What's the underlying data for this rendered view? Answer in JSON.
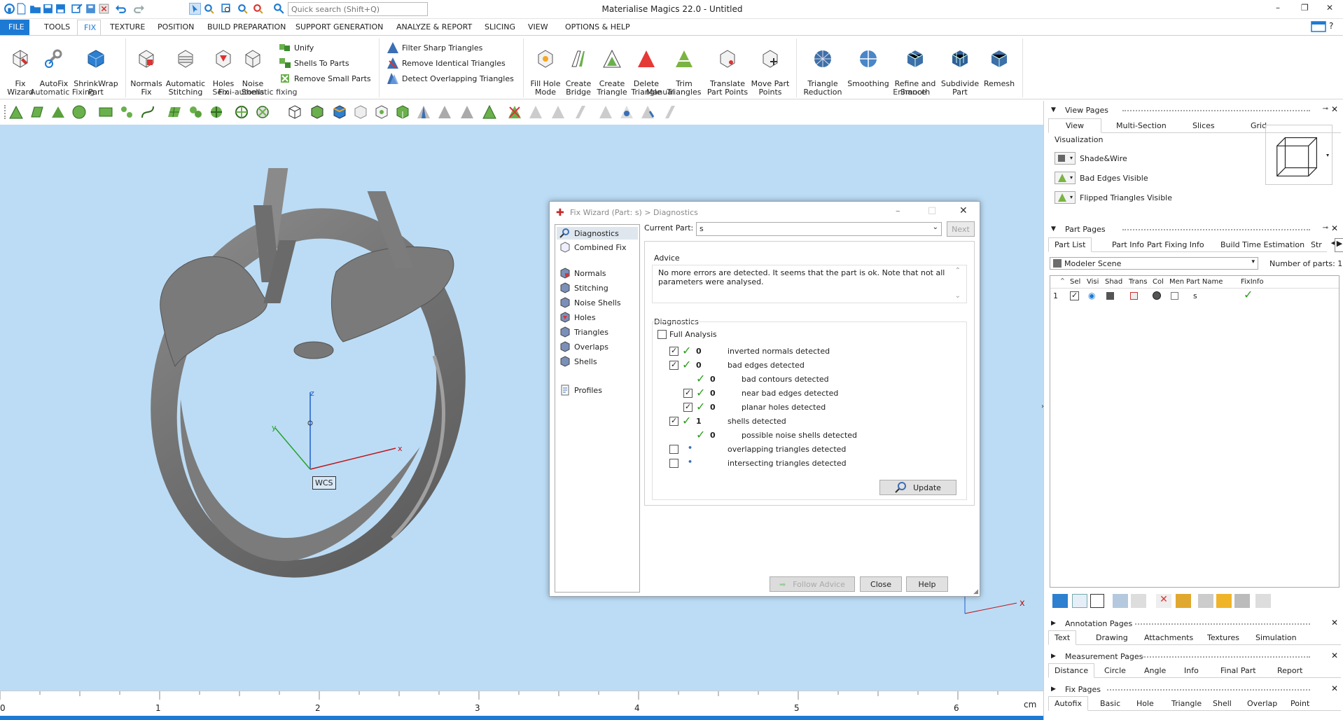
{
  "title_bar": {
    "window_title": "Materialise Magics 22.0 - Untitled",
    "search_placeholder": "Quick search (Shift+Q)",
    "minimize": "–",
    "restore": "❐",
    "close": "✕"
  },
  "menu": {
    "file": "FILE",
    "items": [
      "TOOLS",
      "FIX",
      "TEXTURE",
      "POSITION",
      "BUILD PREPARATION",
      "SUPPORT GENERATION",
      "ANALYZE & REPORT",
      "SLICING",
      "VIEW",
      "OPTIONS & HELP"
    ],
    "active": "FIX"
  },
  "ribbon": {
    "automatic_fixing": {
      "label": "Automatic Fixing",
      "buttons": [
        "Fix\nWizard",
        "AutoFix",
        "ShrinkWrap\nPart"
      ]
    },
    "semi_automatic": {
      "label": "Semi-automatic fixing",
      "buttons": [
        "Normals\nFix",
        "Automatic\nStitching",
        "Holes\nFix",
        "Noise\nShells"
      ],
      "small": [
        "Unify",
        "Shells To Parts",
        "Remove Small Parts"
      ]
    },
    "triangles_small": [
      "Filter Sharp Triangles",
      "Remove Identical Triangles",
      "Detect Overlapping Triangles"
    ],
    "manual": {
      "label": "Manual",
      "buttons": [
        "Fill Hole\nMode",
        "Create\nBridge",
        "Create\nTriangle",
        "Delete\nTriangle",
        "Trim\nTriangles",
        "Translate\nPart Points",
        "Move Part\nPoints"
      ]
    },
    "enhance": {
      "label": "Enhance",
      "buttons": [
        "Triangle\nReduction",
        "Smoothing",
        "Refine and\nSmooth",
        "Subdivide\nPart",
        "Remesh"
      ]
    }
  },
  "viewport": {
    "axis_x": "x",
    "axis_y": "y",
    "axis_z": "z",
    "wcs_label": "WCS",
    "corner_x": "x"
  },
  "ruler": {
    "ticks": [
      "0",
      "1",
      "2",
      "3",
      "4",
      "5",
      "6"
    ],
    "unit": "cm"
  },
  "view_pages": {
    "header": "View Pages",
    "tabs": [
      "View",
      "Multi-Section",
      "Slices",
      "Grid"
    ],
    "visualization_label": "Visualization",
    "options": [
      "Shade&Wire",
      "Bad Edges Visible",
      "Flipped Triangles Visible"
    ]
  },
  "part_pages": {
    "header": "Part Pages",
    "tabs": [
      "Part List",
      "Part Info",
      "Part Fixing Info",
      "Build Time Estimation",
      "Str"
    ],
    "scene": "Modeler Scene",
    "num_parts_label": "Number of parts:",
    "num_parts": "1",
    "columns": [
      "Sel",
      "Visi",
      "Shad",
      "Trans",
      "Col",
      "Men",
      "Part Name",
      "FixInfo"
    ],
    "row": {
      "index": "1",
      "name": "s"
    }
  },
  "annotation_pages": {
    "header": "Annotation Pages",
    "tabs": [
      "Text",
      "Drawing",
      "Attachments",
      "Textures",
      "Simulation"
    ]
  },
  "measurement_pages": {
    "header": "Measurement Pages",
    "tabs": [
      "Distance",
      "Circle",
      "Angle",
      "Info",
      "Final Part",
      "Report"
    ]
  },
  "fix_pages": {
    "header": "Fix Pages",
    "tabs": [
      "Autofix",
      "Basic",
      "Hole",
      "Triangle",
      "Shell",
      "Overlap",
      "Point"
    ]
  },
  "dialog": {
    "title": "Fix Wizard (Part: s) > Diagnostics",
    "sidebar": [
      "Diagnostics",
      "Combined Fix",
      "Normals",
      "Stitching",
      "Noise Shells",
      "Holes",
      "Triangles",
      "Overlaps",
      "Shells",
      "Profiles"
    ],
    "current_part_label": "Current Part:",
    "current_part": "s",
    "next": "Next",
    "advice_label": "Advice",
    "advice_text": "No more errors are detected. It seems that the part is ok. Note that not all parameters were analysed.",
    "diagnostics_label": "Diagnostics",
    "full_analysis": "Full Analysis",
    "rows": [
      {
        "value": "0",
        "text": "inverted normals detected"
      },
      {
        "value": "0",
        "text": "bad edges detected"
      },
      {
        "value": "0",
        "text": "bad contours detected"
      },
      {
        "value": "0",
        "text": "near bad edges detected"
      },
      {
        "value": "0",
        "text": "planar holes detected"
      },
      {
        "value": "1",
        "text": "shells detected"
      },
      {
        "value": "0",
        "text": "possible noise shells detected"
      },
      {
        "value": "•",
        "text": "overlapping triangles detected"
      },
      {
        "value": "•",
        "text": "intersecting triangles detected"
      }
    ],
    "update": "Update",
    "follow_advice": "Follow Advice",
    "close": "Close",
    "help": "Help"
  }
}
